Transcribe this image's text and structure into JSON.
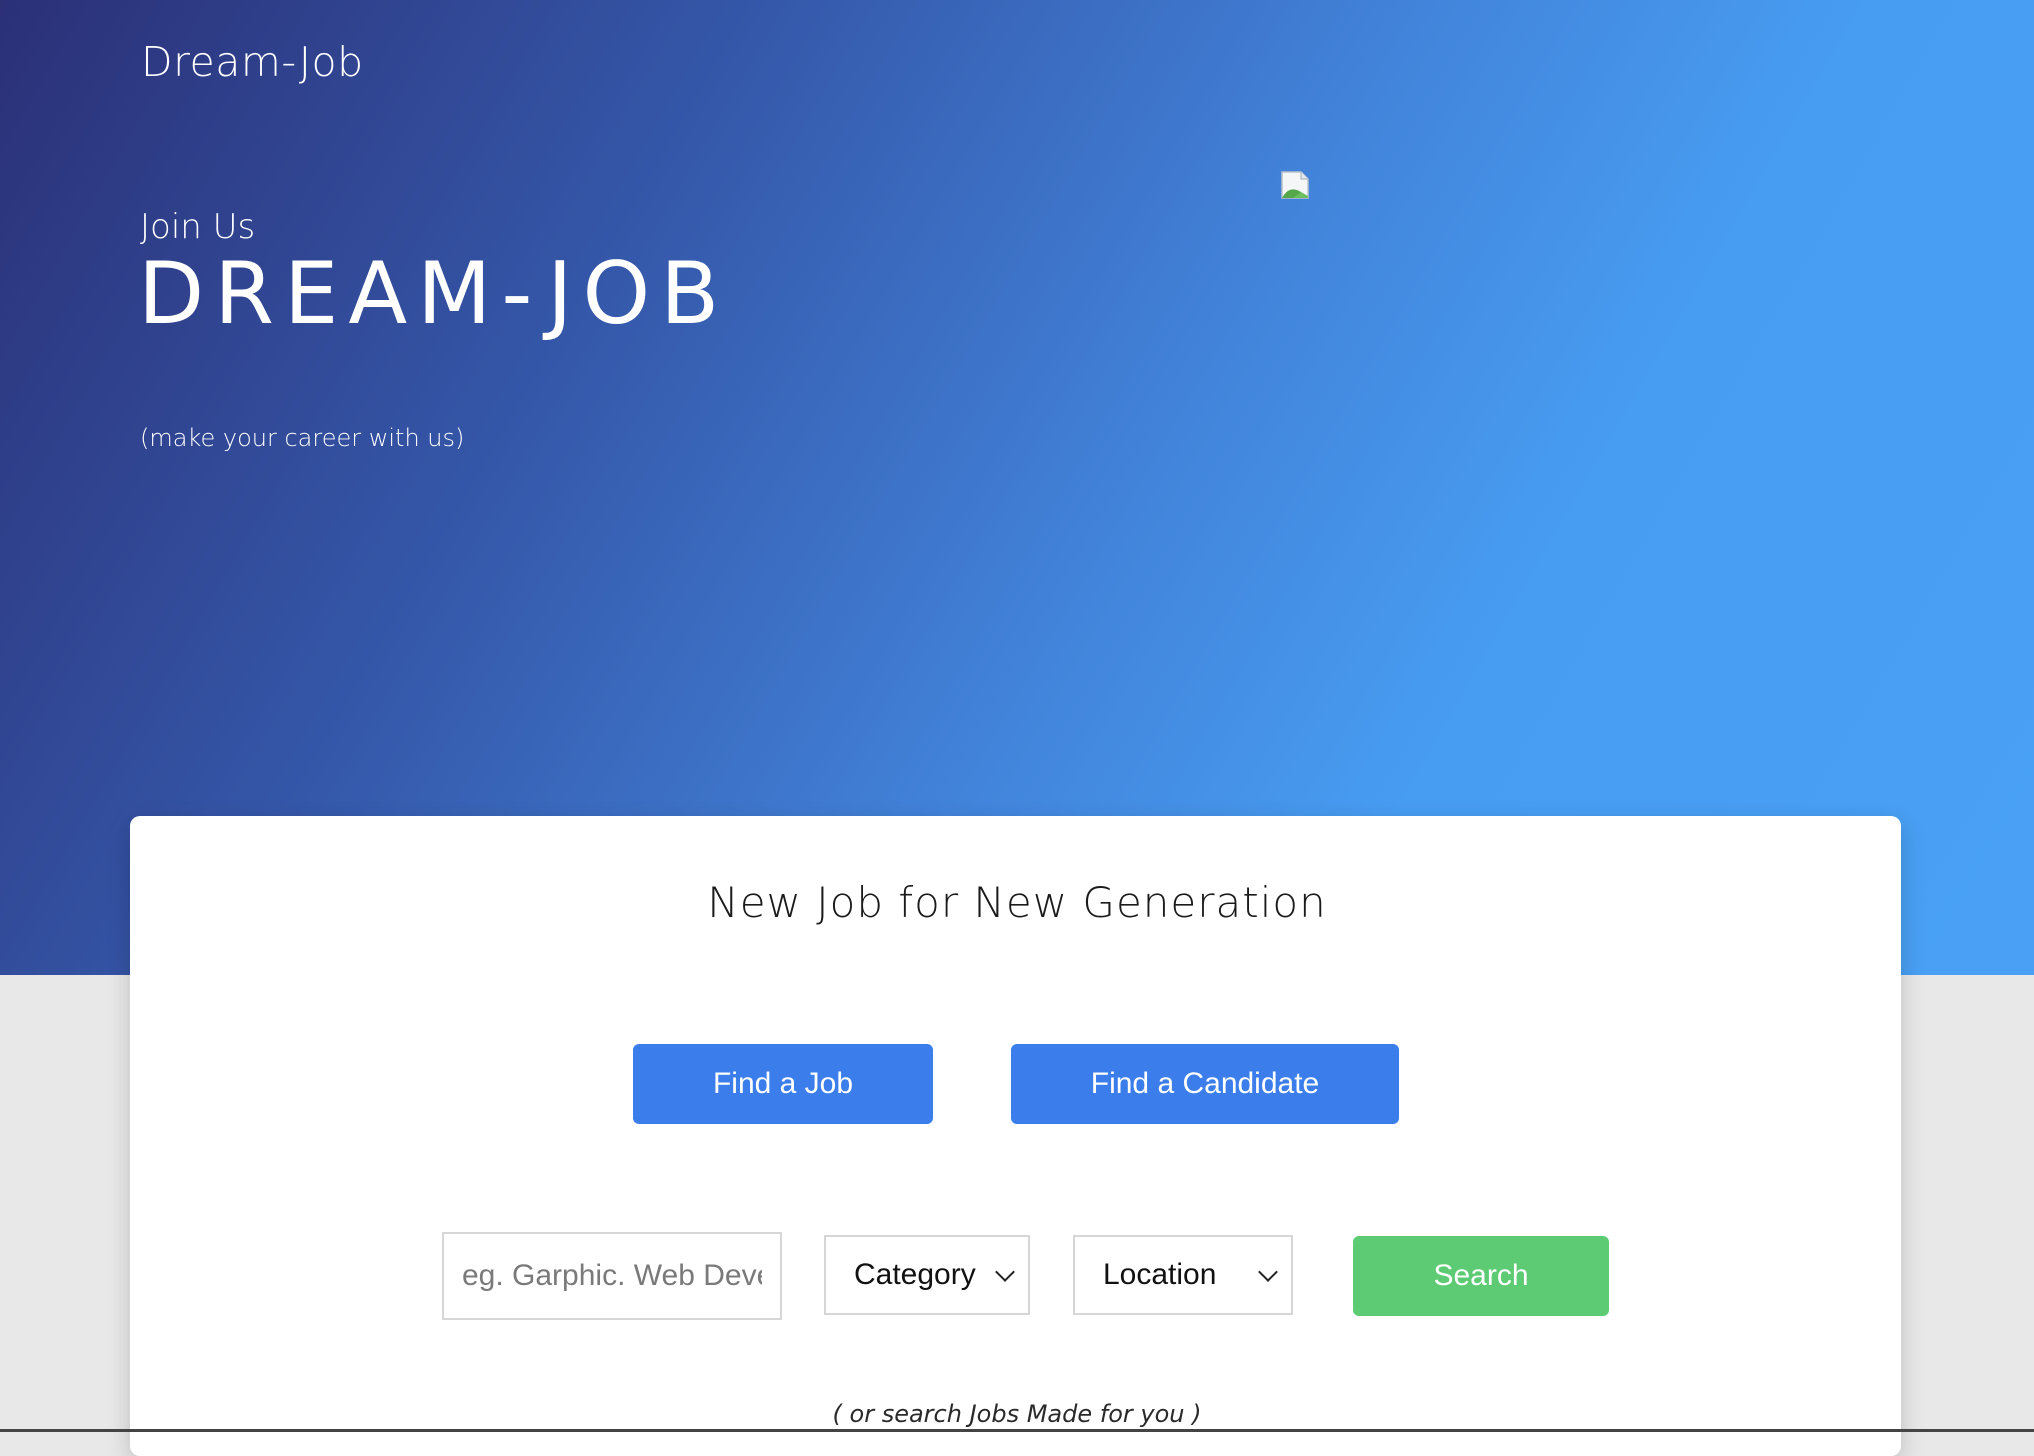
{
  "header": {
    "brand": "Dream-Job"
  },
  "hero": {
    "kicker": "Join Us",
    "headline": "DREAM-JOB",
    "tagline": "(make your career with us)",
    "image_icon": "broken-image-icon"
  },
  "card": {
    "title": "New Job for New Generation",
    "find_job_label": "Find a Job",
    "find_candidate_label": "Find a Candidate",
    "search": {
      "placeholder": "eg. Garphic. Web Developer",
      "category_label": "Category",
      "location_label": "Location",
      "button_label": "Search"
    },
    "footer_hint": "( or search Jobs Made for you )"
  },
  "colors": {
    "hero_gradient_start": "#2b3077",
    "hero_gradient_end": "#49a0f4",
    "primary_button": "#3b7deb",
    "search_button": "#5ccb73",
    "page_background": "#e8e8e8"
  }
}
